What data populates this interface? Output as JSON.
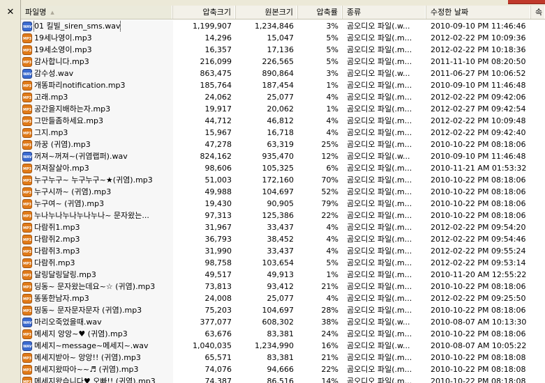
{
  "close_symbol": "✕",
  "headers": {
    "name": "파일명",
    "compressed": "압축크기",
    "original": "원본크기",
    "ratio": "압축률",
    "type": "종류",
    "modified": "수정한 날짜",
    "extra": "속"
  },
  "sort": {
    "column": "name",
    "direction": "ascending"
  },
  "files": [
    {
      "icon": "wav",
      "name": "01 킬빌_siren_sms.wav",
      "compressed": "1,199,907",
      "original": "1,234,846",
      "ratio": "3%",
      "type": "곰오디오 파일(.w...",
      "modified": "2010-09-10 PM 11:46:46"
    },
    {
      "icon": "mp3",
      "name": "19세나영이.mp3",
      "compressed": "14,296",
      "original": "15,047",
      "ratio": "5%",
      "type": "곰오디오 파일(.m...",
      "modified": "2012-02-22 PM 10:09:36"
    },
    {
      "icon": "mp3",
      "name": "19세소영이.mp3",
      "compressed": "16,357",
      "original": "17,136",
      "ratio": "5%",
      "type": "곰오디오 파일(.m...",
      "modified": "2012-02-22 PM 10:18:36"
    },
    {
      "icon": "mp3",
      "name": "감사합니다.mp3",
      "compressed": "216,099",
      "original": "226,565",
      "ratio": "5%",
      "type": "곰오디오 파일(.m...",
      "modified": "2011-11-10 PM 08:20:50"
    },
    {
      "icon": "wav",
      "name": "감수성.wav",
      "compressed": "863,475",
      "original": "890,864",
      "ratio": "3%",
      "type": "곰오디오 파일(.w...",
      "modified": "2011-06-27 PM 10:06:52"
    },
    {
      "icon": "mp3",
      "name": "개똥파리notification.mp3",
      "compressed": "185,764",
      "original": "187,454",
      "ratio": "1%",
      "type": "곰오디오 파일(.m...",
      "modified": "2010-09-10 PM 11:46:48"
    },
    {
      "icon": "mp3",
      "name": "고래.mp3",
      "compressed": "24,062",
      "original": "25,077",
      "ratio": "4%",
      "type": "곰오디오 파일(.m...",
      "modified": "2012-02-22 PM 09:42:06"
    },
    {
      "icon": "mp3",
      "name": "공간을지배하는자.mp3",
      "compressed": "19,917",
      "original": "20,062",
      "ratio": "1%",
      "type": "곰오디오 파일(.m...",
      "modified": "2012-02-27 PM 09:42:54"
    },
    {
      "icon": "mp3",
      "name": "그만들좀하세요.mp3",
      "compressed": "44,712",
      "original": "46,812",
      "ratio": "4%",
      "type": "곰오디오 파일(.m...",
      "modified": "2012-02-22 PM 10:09:48"
    },
    {
      "icon": "mp3",
      "name": "그지.mp3",
      "compressed": "15,967",
      "original": "16,718",
      "ratio": "4%",
      "type": "곰오디오 파일(.m...",
      "modified": "2012-02-22 PM 09:42:40"
    },
    {
      "icon": "mp3",
      "name": "까꿍 (귀염).mp3",
      "compressed": "47,278",
      "original": "63,319",
      "ratio": "25%",
      "type": "곰오디오 파일(.m...",
      "modified": "2010-10-22 PM 08:18:06"
    },
    {
      "icon": "wav",
      "name": "꺼져~꺼져~(귀염랩퍼).wav",
      "compressed": "824,162",
      "original": "935,470",
      "ratio": "12%",
      "type": "곰오디오 파일(.w...",
      "modified": "2010-09-10 PM 11:46:48"
    },
    {
      "icon": "mp3",
      "name": "꺼져잘살아.mp3",
      "compressed": "98,606",
      "original": "105,325",
      "ratio": "6%",
      "type": "곰오디오 파일(.m...",
      "modified": "2010-11-21 AM 01:53:32"
    },
    {
      "icon": "mp3",
      "name": "누구누구~ 누구누구~★(귀염).mp3",
      "compressed": "51,003",
      "original": "172,160",
      "ratio": "70%",
      "type": "곰오디오 파일(.m...",
      "modified": "2010-10-22 PM 08:18:06"
    },
    {
      "icon": "mp3",
      "name": "누구시까~ (귀염).mp3",
      "compressed": "49,988",
      "original": "104,697",
      "ratio": "52%",
      "type": "곰오디오 파일(.m...",
      "modified": "2010-10-22 PM 08:18:06"
    },
    {
      "icon": "mp3",
      "name": "누구여~ (귀염).mp3",
      "compressed": "19,430",
      "original": "90,905",
      "ratio": "79%",
      "type": "곰오디오 파일(.m...",
      "modified": "2010-10-22 PM 08:18:06"
    },
    {
      "icon": "mp3",
      "name": "누나누나누나누나누나~ 문자왔는...",
      "compressed": "97,313",
      "original": "125,386",
      "ratio": "22%",
      "type": "곰오디오 파일(.m...",
      "modified": "2010-10-22 PM 08:18:06"
    },
    {
      "icon": "mp3",
      "name": "다람쥐1.mp3",
      "compressed": "31,967",
      "original": "33,437",
      "ratio": "4%",
      "type": "곰오디오 파일(.m...",
      "modified": "2012-02-22 PM 09:54:20"
    },
    {
      "icon": "mp3",
      "name": "다람쥐2.mp3",
      "compressed": "36,793",
      "original": "38,452",
      "ratio": "4%",
      "type": "곰오디오 파일(.m...",
      "modified": "2012-02-22 PM 09:54:46"
    },
    {
      "icon": "mp3",
      "name": "다람쥐3.mp3",
      "compressed": "31,990",
      "original": "33,437",
      "ratio": "4%",
      "type": "곰오디오 파일(.m...",
      "modified": "2012-02-22 PM 09:55:24"
    },
    {
      "icon": "mp3",
      "name": "다람쥐.mp3",
      "compressed": "98,758",
      "original": "103,654",
      "ratio": "5%",
      "type": "곰오디오 파일(.m...",
      "modified": "2012-02-22 PM 09:53:14"
    },
    {
      "icon": "mp3",
      "name": "달링달링달링.mp3",
      "compressed": "49,517",
      "original": "49,913",
      "ratio": "1%",
      "type": "곰오디오 파일(.m...",
      "modified": "2010-11-20 AM 12:55:22"
    },
    {
      "icon": "mp3",
      "name": "딩동~ 문자왔는데요~☆ (귀염).mp3",
      "compressed": "73,813",
      "original": "93,412",
      "ratio": "21%",
      "type": "곰오디오 파일(.m...",
      "modified": "2010-10-22 PM 08:18:06"
    },
    {
      "icon": "mp3",
      "name": "똥똥한남자.mp3",
      "compressed": "24,008",
      "original": "25,077",
      "ratio": "4%",
      "type": "곰오디오 파일(.m...",
      "modified": "2012-02-22 PM 09:25:50"
    },
    {
      "icon": "mp3",
      "name": "띵동~ 문자문자문자 (귀염).mp3",
      "compressed": "75,203",
      "original": "104,697",
      "ratio": "28%",
      "type": "곰오디오 파일(.m...",
      "modified": "2010-10-22 PM 08:18:06"
    },
    {
      "icon": "wav",
      "name": "마리오죽었을때.wav",
      "compressed": "377,077",
      "original": "608,302",
      "ratio": "38%",
      "type": "곰오디오 파일(.w...",
      "modified": "2010-08-07 AM 10:13:30"
    },
    {
      "icon": "mp3",
      "name": "메세지 앙앙~♥ (귀염).mp3",
      "compressed": "63,676",
      "original": "83,381",
      "ratio": "24%",
      "type": "곰오디오 파일(.m...",
      "modified": "2010-10-22 PM 08:18:06"
    },
    {
      "icon": "wav",
      "name": "메세지~message~메세지~.wav",
      "compressed": "1,040,035",
      "original": "1,234,990",
      "ratio": "16%",
      "type": "곰오디오 파일(.w...",
      "modified": "2010-08-07 AM 10:05:22"
    },
    {
      "icon": "mp3",
      "name": "메세지받아~ 앙앙!! (귀염).mp3",
      "compressed": "65,571",
      "original": "83,381",
      "ratio": "21%",
      "type": "곰오디오 파일(.m...",
      "modified": "2010-10-22 PM 08:18:08"
    },
    {
      "icon": "mp3",
      "name": "메세지왔따아~~♬ (귀염).mp3",
      "compressed": "74,076",
      "original": "94,666",
      "ratio": "22%",
      "type": "곰오디오 파일(.m...",
      "modified": "2010-10-22 PM 08:18:08"
    },
    {
      "icon": "mp3",
      "name": "메세지왔습니다♥ 오빠!! (귀염).mp3",
      "compressed": "74,387",
      "original": "86,516",
      "ratio": "14%",
      "type": "곰오디오 파일(.m...",
      "modified": "2010-10-22 PM 08:18:08"
    }
  ]
}
